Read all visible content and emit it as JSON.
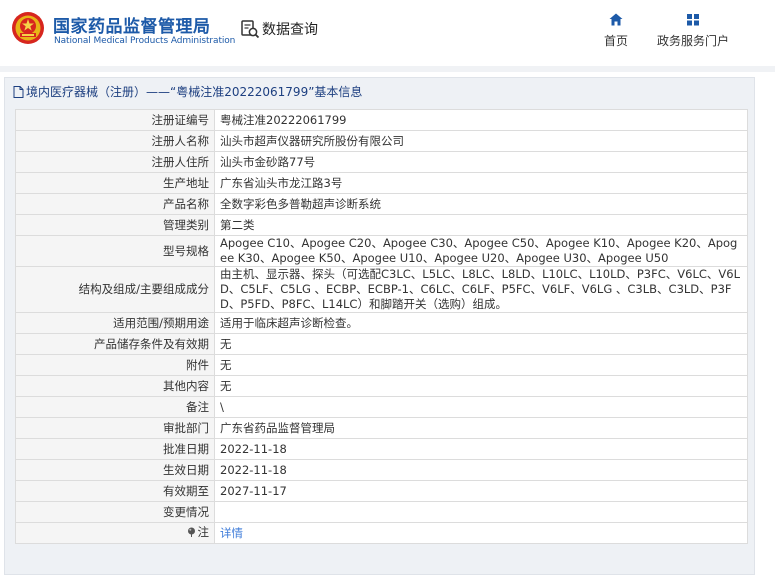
{
  "header": {
    "brand_cn": "国家药品监督管理局",
    "brand_en": "National Medical Products Administration",
    "search_label": "数据查询",
    "nav": {
      "home": "首页",
      "service": "政务服务门户"
    }
  },
  "panel": {
    "title": "境内医疗器械（注册）——“粤械注准20222061799”基本信息"
  },
  "rows": [
    {
      "label": "注册证编号",
      "value": "粤械注准20222061799"
    },
    {
      "label": "注册人名称",
      "value": "汕头市超声仪器研究所股份有限公司"
    },
    {
      "label": "注册人住所",
      "value": "汕头市金砂路77号"
    },
    {
      "label": "生产地址",
      "value": "广东省汕头市龙江路3号"
    },
    {
      "label": "产品名称",
      "value": "全数字彩色多普勒超声诊断系统"
    },
    {
      "label": "管理类别",
      "value": "第二类"
    },
    {
      "label": "型号规格",
      "value": "Apogee C10、Apogee C20、Apogee C30、Apogee C50、Apogee K10、Apogee K20、Apogee K30、Apogee K50、Apogee U10、Apogee U20、Apogee U30、Apogee U50"
    },
    {
      "label": "结构及组成/主要组成成分",
      "value": "由主机、显示器、探头（可选配C3LC、L5LC、L8LC、L8LD、L10LC、L10LD、P3FC、V6LC、V6LD、C5LF、C5LG 、ECBP、ECBP-1、C6LC、C6LF、P5FC、V6LF、V6LG 、C3LB、C3LD、P3FD、P5FD、P8FC、L14LC）和脚踏开关（选购）组成。"
    },
    {
      "label": "适用范围/预期用途",
      "value": "适用于临床超声诊断检查。"
    },
    {
      "label": "产品储存条件及有效期",
      "value": "无"
    },
    {
      "label": "附件",
      "value": "无"
    },
    {
      "label": "其他内容",
      "value": "无"
    },
    {
      "label": "备注",
      "value": "\\"
    },
    {
      "label": "审批部门",
      "value": "广东省药品监督管理局"
    },
    {
      "label": "批准日期",
      "value": "2022-11-18"
    },
    {
      "label": "生效日期",
      "value": "2022-11-18"
    },
    {
      "label": "有效期至",
      "value": "2027-11-17"
    },
    {
      "label": "变更情况",
      "value": ""
    },
    {
      "label": "注",
      "value": "详情"
    }
  ]
}
